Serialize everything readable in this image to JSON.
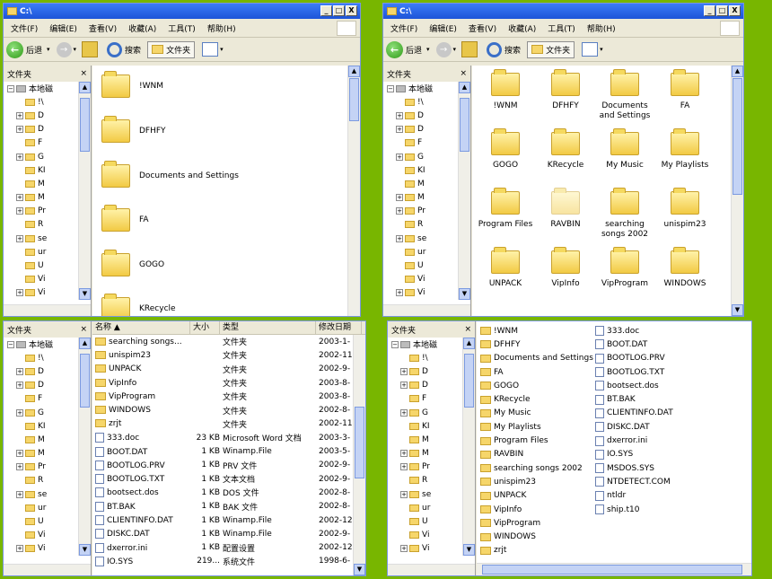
{
  "window": {
    "title": "C:\\",
    "minimize": "_",
    "maximize": "□",
    "close": "X"
  },
  "menu": [
    "文件(F)",
    "编辑(E)",
    "查看(V)",
    "收藏(A)",
    "工具(T)",
    "帮助(H)"
  ],
  "toolbar": {
    "back_label": "后退",
    "search_label": "搜索",
    "folders_label": "文件夹"
  },
  "nav": {
    "header": "文件夹",
    "close": "×",
    "root": "本地磁",
    "items": [
      "!\\",
      "D",
      "D",
      "F",
      "G",
      "KI",
      "M",
      "M",
      "Pr",
      "R",
      "se",
      "ur",
      "U",
      "Vi",
      "Vi",
      "W"
    ]
  },
  "icons_view": [
    "!WNM",
    "DFHFY",
    "Documents and Settings",
    "FA",
    "GOGO",
    "KRecycle",
    "My Music",
    "My Playlists",
    "Program Files",
    "RAVBIN",
    "searching songs 2002",
    "unispim23",
    "UNPACK",
    "VipInfo",
    "VipProgram",
    "WINDOWS"
  ],
  "tiles_view": [
    "!WNM",
    "DFHFY",
    "Documents and Settings",
    "FA",
    "GOGO",
    "KRecycle"
  ],
  "details": {
    "headers": [
      "名称 ▲",
      "大小",
      "类型",
      "修改日期"
    ],
    "rows": [
      [
        "searching songs...",
        "",
        "文件夹",
        "2003-1-"
      ],
      [
        "unispim23",
        "",
        "文件夹",
        "2002-11"
      ],
      [
        "UNPACK",
        "",
        "文件夹",
        "2002-9-"
      ],
      [
        "VipInfo",
        "",
        "文件夹",
        "2003-8-"
      ],
      [
        "VipProgram",
        "",
        "文件夹",
        "2003-8-"
      ],
      [
        "WINDOWS",
        "",
        "文件夹",
        "2002-8-"
      ],
      [
        "zrjt",
        "",
        "文件夹",
        "2002-11"
      ],
      [
        "333.doc",
        "23 KB",
        "Microsoft Word 文档",
        "2003-3-"
      ],
      [
        "BOOT.DAT",
        "1 KB",
        "Winamp.File",
        "2003-5-"
      ],
      [
        "BOOTLOG.PRV",
        "1 KB",
        "PRV 文件",
        "2002-9-"
      ],
      [
        "BOOTLOG.TXT",
        "1 KB",
        "文本文档",
        "2002-9-"
      ],
      [
        "bootsect.dos",
        "1 KB",
        "DOS 文件",
        "2002-8-"
      ],
      [
        "BT.BAK",
        "1 KB",
        "BAK 文件",
        "2002-8-"
      ],
      [
        "CLIENTINFO.DAT",
        "1 KB",
        "Winamp.File",
        "2002-12"
      ],
      [
        "DISKC.DAT",
        "1 KB",
        "Winamp.File",
        "2002-9-"
      ],
      [
        "dxerror.ini",
        "1 KB",
        "配置设置",
        "2002-12"
      ],
      [
        "IO.SYS",
        "219...",
        "系统文件",
        "1998-6-"
      ]
    ]
  },
  "list_col1": [
    "!WNM",
    "DFHFY",
    "Documents and Settings",
    "FA",
    "GOGO",
    "KRecycle",
    "My Music",
    "My Playlists",
    "Program Files",
    "RAVBIN",
    "searching songs 2002",
    "unispim23",
    "UNPACK",
    "VipInfo",
    "VipProgram",
    "WINDOWS",
    "zrjt"
  ],
  "list_col2": [
    "333.doc",
    "BOOT.DAT",
    "BOOTLOG.PRV",
    "BOOTLOG.TXT",
    "bootsect.dos",
    "BT.BAK",
    "CLIENTINFO.DAT",
    "DISKC.DAT",
    "dxerror.ini",
    "IO.SYS",
    "MSDOS.SYS",
    "NTDETECT.COM",
    "ntldr",
    "ship.t10"
  ],
  "colors": {
    "titlebar": "#2a62e0",
    "desktop": "#78b600",
    "folder": "#f6d66a",
    "chrome": "#ece9d8"
  }
}
